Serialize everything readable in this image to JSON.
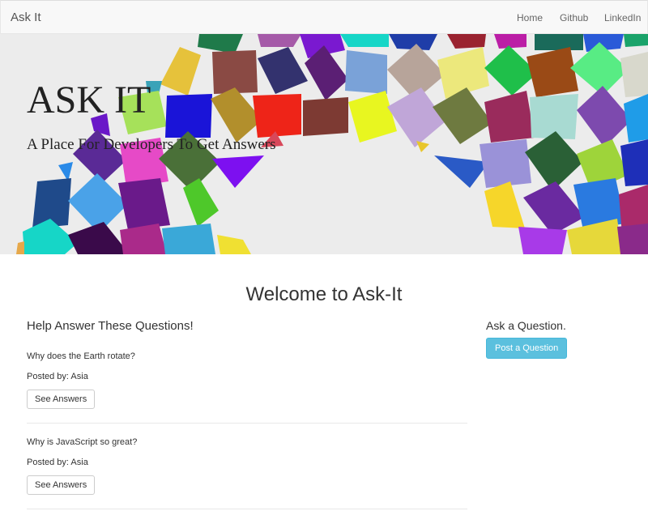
{
  "navbar": {
    "brand": "Ask It",
    "links": [
      "Home",
      "Github",
      "LinkedIn"
    ]
  },
  "hero": {
    "title": "ASK IT",
    "subtitle": "A Place For Developers To Get Answers"
  },
  "main": {
    "welcome": "Welcome to Ask-It",
    "questions_heading": "Help Answer These Questions!",
    "questions": [
      {
        "text": "Why does the Earth rotate?",
        "posted_by": "Posted by: Asia",
        "button": "See Answers"
      },
      {
        "text": "Why is JavaScript so great?",
        "posted_by": "Posted by: Asia",
        "button": "See Answers"
      }
    ]
  },
  "sidebar": {
    "heading": "Ask a Question.",
    "button": "Post a Question"
  },
  "colors": {
    "navbar_bg": "#f8f8f8",
    "hero_bg": "#ececec",
    "post_button": "#5bc0de"
  }
}
